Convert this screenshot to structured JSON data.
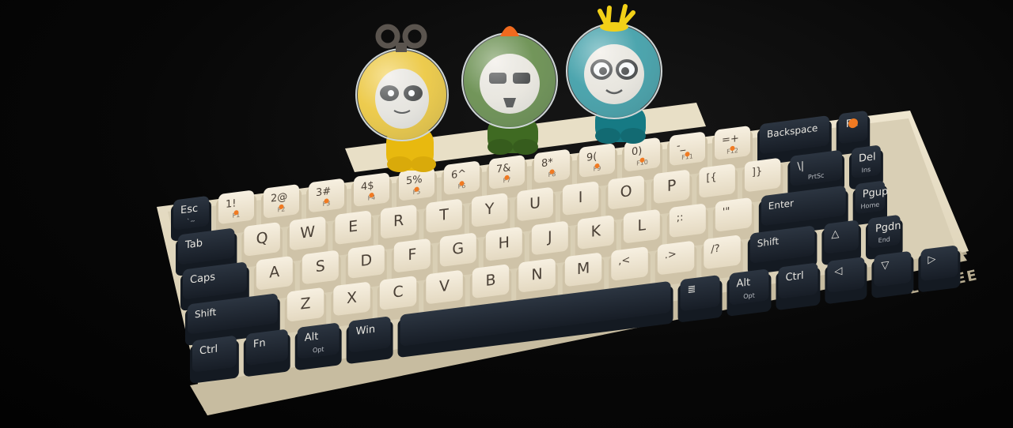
{
  "colors": {
    "background": "#050505",
    "case": "#e6dcc4",
    "case_shadow": "#b9ae93",
    "cream_key": "#f1e9d8",
    "cream_key_side": "#cfc3a8",
    "dark_key": "#1f2733",
    "dark_key_side": "#141a22",
    "legend_dark": "#4a4036",
    "legend_light": "#e8e6e0",
    "accent_orange": "#f07a22",
    "figure_yellow": "#f2c21a",
    "figure_green": "#4e7a2a",
    "figure_teal": "#1c8f9a"
  },
  "brand": {
    "logo": "LOFREE"
  },
  "figures": [
    {
      "name": "yellow",
      "color": "#f2c21a",
      "topper": "wind-up-key"
    },
    {
      "name": "green",
      "color": "#4e7a2a",
      "topper": "orange-spike"
    },
    {
      "name": "teal",
      "color": "#1c8f9a",
      "topper": "yellow-antlers"
    }
  ],
  "keys": {
    "row1": [
      {
        "l": "Esc",
        "s": "`~",
        "d": true
      },
      {
        "l": "1!",
        "s": "F1"
      },
      {
        "l": "2@",
        "s": "F2"
      },
      {
        "l": "3#",
        "s": "F3"
      },
      {
        "l": "4$",
        "s": "F4"
      },
      {
        "l": "5%",
        "s": "F5"
      },
      {
        "l": "6^",
        "s": "F6"
      },
      {
        "l": "7&",
        "s": "F7"
      },
      {
        "l": "8*",
        "s": "F8"
      },
      {
        "l": "9(",
        "s": "F9"
      },
      {
        "l": "0)",
        "s": "F10"
      },
      {
        "l": "-_",
        "s": "F11"
      },
      {
        "l": "=+",
        "s": "F12"
      },
      {
        "l": "Backspace",
        "s": "",
        "d": true
      },
      {
        "l": "Fn",
        "s": "",
        "d": true,
        "dot": true
      }
    ],
    "row2": [
      {
        "l": "Tab",
        "d": true
      },
      {
        "l": "Q"
      },
      {
        "l": "W"
      },
      {
        "l": "E"
      },
      {
        "l": "R"
      },
      {
        "l": "T"
      },
      {
        "l": "Y"
      },
      {
        "l": "U"
      },
      {
        "l": "I"
      },
      {
        "l": "O"
      },
      {
        "l": "P"
      },
      {
        "l": "[{"
      },
      {
        "l": "]}"
      },
      {
        "l": "\\|",
        "s": "PrtSc",
        "d": true
      },
      {
        "l": "Del",
        "s": "Ins",
        "d": true
      }
    ],
    "row3": [
      {
        "l": "Caps",
        "d": true
      },
      {
        "l": "A"
      },
      {
        "l": "S"
      },
      {
        "l": "D"
      },
      {
        "l": "F"
      },
      {
        "l": "G"
      },
      {
        "l": "H"
      },
      {
        "l": "J"
      },
      {
        "l": "K"
      },
      {
        "l": "L"
      },
      {
        "l": ";:"
      },
      {
        "l": "'\""
      },
      {
        "l": "Enter",
        "d": true
      },
      {
        "l": "Pgup",
        "s": "Home",
        "d": true
      }
    ],
    "row4": [
      {
        "l": "Shift",
        "d": true
      },
      {
        "l": "Z"
      },
      {
        "l": "X"
      },
      {
        "l": "C"
      },
      {
        "l": "V"
      },
      {
        "l": "B"
      },
      {
        "l": "N"
      },
      {
        "l": "M"
      },
      {
        "l": ",<"
      },
      {
        "l": ".>"
      },
      {
        "l": "/?"
      },
      {
        "l": "Shift",
        "d": true
      },
      {
        "l": "△",
        "d": true
      },
      {
        "l": "Pgdn",
        "s": "End",
        "d": true
      }
    ],
    "row5": [
      {
        "l": "Ctrl",
        "d": true
      },
      {
        "l": "Fn",
        "d": true
      },
      {
        "l": "Alt",
        "s": "Opt",
        "d": true
      },
      {
        "l": "Win",
        "s": "",
        "d": true
      },
      {
        "l": "",
        "d": true
      },
      {
        "l": "≣",
        "d": true
      },
      {
        "l": "Alt",
        "s": "Opt",
        "d": true
      },
      {
        "l": "Ctrl",
        "d": true
      },
      {
        "l": "◁",
        "d": true
      },
      {
        "l": "▽",
        "d": true
      },
      {
        "l": "▷",
        "d": true
      }
    ]
  }
}
